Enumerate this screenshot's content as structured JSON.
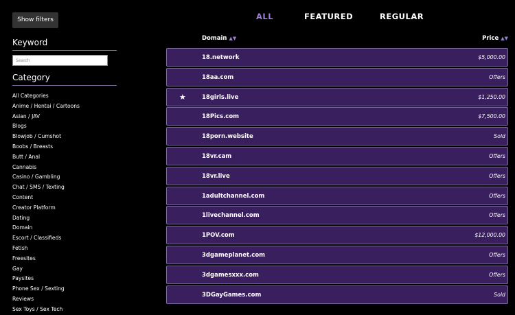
{
  "sidebar": {
    "filters_button": "Show filters",
    "keyword_heading": "Keyword",
    "search_placeholder": "Search",
    "category_heading": "Category",
    "categories": [
      "All Categories",
      "Anime / Hentai / Cartoons",
      "Asian / JAV",
      "Blogs",
      "Blowjob / Cumshot",
      "Boobs / Breasts",
      "Butt / Anal",
      "Cannabis",
      "Casino / Gambling",
      "Chat / SMS / Texting",
      "Content",
      "Creator Platform",
      "Dating",
      "Domain",
      "Escort / Classifieds",
      "Fetish",
      "Freesites",
      "Gay",
      "Paysites",
      "Phone Sex / Sexting",
      "Reviews",
      "Sex Toys / Sex Tech"
    ]
  },
  "tabs": {
    "all": "ALL",
    "featured": "FEATURED",
    "regular": "REGULAR",
    "active_color": "#9a7fd0"
  },
  "table": {
    "domain_header": "Domain",
    "price_header": "Price",
    "sort_arrows": "▲▼",
    "rows": [
      {
        "domain": "18.network",
        "price": "$5,000.00",
        "featured": false
      },
      {
        "domain": "18aa.com",
        "price": "Offers",
        "featured": false
      },
      {
        "domain": "18girls.live",
        "price": "$1,250.00",
        "featured": true
      },
      {
        "domain": "18Pics.com",
        "price": "$7,500.00",
        "featured": false
      },
      {
        "domain": "18porn.website",
        "price": "Sold",
        "featured": false
      },
      {
        "domain": "18vr.cam",
        "price": "Offers",
        "featured": false
      },
      {
        "domain": "18vr.live",
        "price": "Offers",
        "featured": false
      },
      {
        "domain": "1adultchannel.com",
        "price": "Offers",
        "featured": false
      },
      {
        "domain": "1livechannel.com",
        "price": "Offers",
        "featured": false
      },
      {
        "domain": "1POV.com",
        "price": "$12,000.00",
        "featured": false
      },
      {
        "domain": "3dgameplanet.com",
        "price": "Offers",
        "featured": false
      },
      {
        "domain": "3dgamesxxx.com",
        "price": "Offers",
        "featured": false
      },
      {
        "domain": "3DGayGames.com",
        "price": "Sold",
        "featured": false
      }
    ]
  },
  "colors": {
    "row_background": "#3a1f5e",
    "row_border": "#7a6a9c",
    "accent": "#9a7fd0"
  },
  "icons": {
    "featured": "star-icon"
  }
}
